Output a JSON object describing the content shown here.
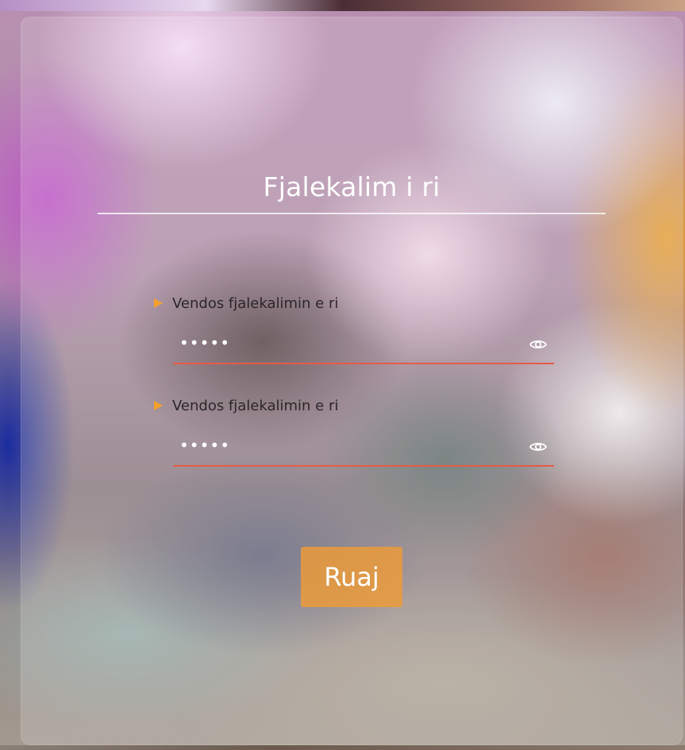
{
  "form": {
    "title": "Fjalekalim i ri",
    "fields": [
      {
        "label": "Vendos fjalekalimin e ri",
        "value": "•••••",
        "type": "password",
        "toggle_icon": "eye-icon"
      },
      {
        "label": "Vendos fjalekalimin e ri",
        "value": "•••••",
        "type": "password",
        "toggle_icon": "eye-icon"
      }
    ],
    "save_label": "Ruaj"
  },
  "colors": {
    "accent": "#f3a02e",
    "button_bg": "#ee9b37",
    "input_underline": "#e55b47",
    "title_text": "#ffffff",
    "label_text": "#2c2628"
  }
}
